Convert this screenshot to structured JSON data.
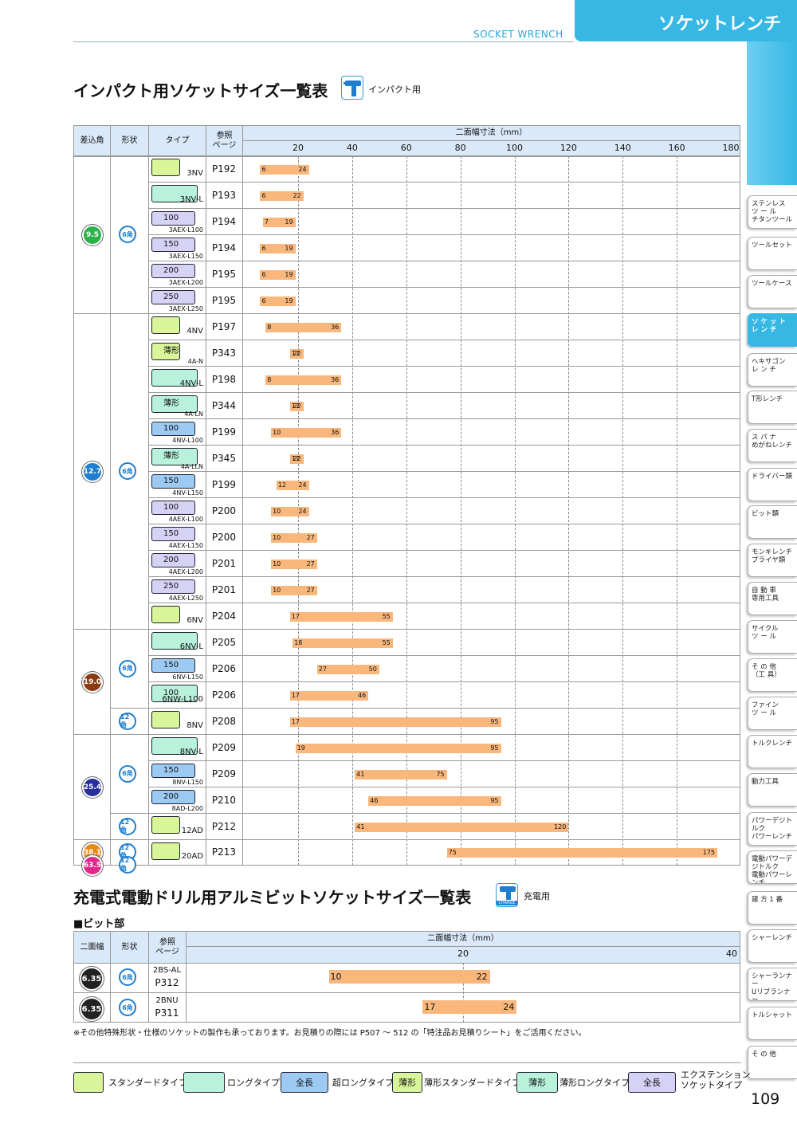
{
  "header": {
    "english": "SOCKET WRENCH",
    "japanese": "ソケットレンチ"
  },
  "sidebar": [
    "ステンレス\nツ ー ル\nチタンツール",
    "ツールセット",
    "ツールケース",
    "ソ ケ ッ ト\nレ ン チ",
    "ヘキサゴン\nレ ン チ",
    "T形レンチ",
    "ス パ ナ\nめがねレンチ",
    "ドライバー類",
    "ビット類",
    "モンキレンチ\nプライヤ類",
    "自 動 車\n専用工具",
    "サイクル\nツ ー ル",
    "そ の 他\n（工 具）",
    "ファイン\nツ ー ル",
    "トルクレンチ",
    "動力工具",
    "パワーデジトルク\nパワーレンチ",
    "電動パワーデジトルク\n電動パワーレンチ\nシンプルトルコン",
    "建 方 1 番",
    "シャーレンチ",
    "シャーランナー\nUリブランナー",
    "トルシャット",
    "そ の 他"
  ],
  "section1": {
    "title": "インパクト用ソケットサイズ一覧表",
    "tag": "インパクト用",
    "headers": {
      "drive": "差込角",
      "shape": "形状",
      "type": "タイプ",
      "ref": "参照\nページ",
      "size": "二面幅寸法（mm）"
    },
    "ticks": [
      "20",
      "40",
      "60",
      "80",
      "100",
      "120",
      "140",
      "160",
      "180"
    ],
    "groups": [
      {
        "drive": "9.5",
        "color": "#2bb34a",
        "rows": [
          0,
          6
        ]
      },
      {
        "drive": "12.7",
        "color": "#1e7fd0",
        "rows": [
          6,
          18
        ]
      },
      {
        "drive": "19.0",
        "color": "#8a3b12",
        "rows": [
          18,
          22
        ]
      },
      {
        "drive": "25.4",
        "color": "#27309a",
        "rows": [
          22,
          26
        ]
      },
      {
        "drive": "38.1",
        "color": "#e88a1a",
        "rows": [
          26,
          27
        ]
      },
      {
        "drive": "63.5",
        "color": "#e0288c",
        "rows": [
          27,
          28
        ]
      }
    ],
    "shapes": [
      {
        "label": "6角",
        "rows": [
          0,
          6
        ]
      },
      {
        "label": "6角",
        "rows": [
          6,
          18
        ]
      },
      {
        "label": "6角",
        "rows": [
          18,
          21
        ]
      },
      {
        "label": "12角",
        "rows": [
          21,
          22
        ]
      },
      {
        "label": "6角",
        "rows": [
          22,
          25
        ]
      },
      {
        "label": "12角",
        "rows": [
          25,
          26
        ]
      },
      {
        "label": "12角",
        "rows": [
          26,
          27
        ]
      },
      {
        "label": "12角",
        "rows": [
          27,
          28
        ]
      }
    ],
    "rows": [
      {
        "kind": "std",
        "label": "",
        "code": "3NV",
        "page": "P192",
        "min": 6,
        "max": 24
      },
      {
        "kind": "long",
        "label": "",
        "code": "3NV-L",
        "page": "P193",
        "min": 6,
        "max": 22
      },
      {
        "kind": "ext",
        "label": "100",
        "code": "3AEX-L100",
        "page": "P194",
        "min": 7,
        "max": 19
      },
      {
        "kind": "ext",
        "label": "150",
        "code": "3AEX-L150",
        "page": "P194",
        "min": 6,
        "max": 19
      },
      {
        "kind": "ext",
        "label": "200",
        "code": "3AEX-L200",
        "page": "P195",
        "min": 6,
        "max": 19
      },
      {
        "kind": "ext",
        "label": "250",
        "code": "3AEX-L250",
        "page": "P195",
        "min": 6,
        "max": 19
      },
      {
        "kind": "std",
        "label": "",
        "code": "4NV",
        "page": "P197",
        "min": 8,
        "max": 36
      },
      {
        "kind": "thin",
        "label": "薄形",
        "code": "4A-N",
        "page": "P343",
        "min": 17,
        "max": 22
      },
      {
        "kind": "long",
        "label": "",
        "code": "4NV-L",
        "page": "P198",
        "min": 8,
        "max": 36
      },
      {
        "kind": "thinlong",
        "label": "薄形",
        "code": "4A-LN",
        "page": "P344",
        "min": 17,
        "max": 22
      },
      {
        "kind": "full",
        "label": "100",
        "code": "4NV-L100",
        "page": "P199",
        "min": 10,
        "max": 36
      },
      {
        "kind": "thinlong",
        "label": "薄形",
        "code": "4A-LLN",
        "page": "P345",
        "min": 17,
        "max": 22
      },
      {
        "kind": "full",
        "label": "150",
        "code": "4NV-L150",
        "page": "P199",
        "min": 12,
        "max": 24
      },
      {
        "kind": "ext",
        "label": "100",
        "code": "4AEX-L100",
        "page": "P200",
        "min": 10,
        "max": 24
      },
      {
        "kind": "ext",
        "label": "150",
        "code": "4AEX-L150",
        "page": "P200",
        "min": 10,
        "max": 27
      },
      {
        "kind": "ext",
        "label": "200",
        "code": "4AEX-L200",
        "page": "P201",
        "min": 10,
        "max": 27
      },
      {
        "kind": "ext",
        "label": "250",
        "code": "4AEX-L250",
        "page": "P201",
        "min": 10,
        "max": 27
      },
      {
        "kind": "std",
        "label": "",
        "code": "6NV",
        "page": "P204",
        "min": 17,
        "max": 55
      },
      {
        "kind": "long",
        "label": "",
        "code": "6NV-L",
        "page": "P205",
        "min": 18,
        "max": 55
      },
      {
        "kind": "full",
        "label": "150",
        "code": "6NV-L150",
        "page": "P206",
        "min": 27,
        "max": 50
      },
      {
        "kind": "long",
        "label": "100",
        "code": "6NW-L100",
        "page": "P206",
        "min": 17,
        "max": 46
      },
      {
        "kind": "std",
        "label": "",
        "code": "8NV",
        "page": "P208",
        "min": 17,
        "max": 95
      },
      {
        "kind": "long",
        "label": "",
        "code": "8NV-L",
        "page": "P209",
        "min": 19,
        "max": 95
      },
      {
        "kind": "full",
        "label": "150",
        "code": "8NV-L150",
        "page": "P209",
        "min": 41,
        "max": 75
      },
      {
        "kind": "full",
        "label": "200",
        "code": "8AD-L200",
        "page": "P210",
        "min": 46,
        "max": 95
      },
      {
        "kind": "std",
        "label": "",
        "code": "12AD",
        "page": "P212",
        "min": 41,
        "max": 120
      },
      {
        "kind": "std",
        "label": "",
        "code": "20AD",
        "page": "P213",
        "min": 75,
        "max": 175
      }
    ]
  },
  "section2": {
    "title": "充電式電動ドリル用アルミビットソケットサイズ一覧表",
    "tag": "充電用",
    "icon_text": "CHARGE",
    "subtitle": "■ビット部",
    "headers": {
      "size": "二面幅",
      "shape": "形状",
      "ref": "参照\nページ",
      "range": "二面幅寸法（mm）"
    },
    "ticks": [
      "20",
      "40"
    ],
    "rows": [
      {
        "size": "6.35",
        "shape": "6角",
        "code": "2BS-AL",
        "page": "P312",
        "min": 10,
        "max": 22
      },
      {
        "size": "6.35",
        "shape": "6角",
        "code": "2BNU",
        "page": "P311",
        "min": 17,
        "max": 24
      }
    ]
  },
  "note": "※その他特殊形状・仕様のソケットの製作も承っております。お見積りの際には P507 ～ 512 の「特注品お見積りシート」をご活用ください。",
  "legend": [
    {
      "box": "",
      "text": "スタンダードタイプ",
      "color": "#d9f59a"
    },
    {
      "box": "",
      "text": "ロングタイプ",
      "color": "#b8f2dc"
    },
    {
      "box": "全長",
      "text": "超ロングタイプ",
      "color": "#9ccaf3"
    },
    {
      "box": "薄形",
      "text": "薄形スタンダードタイプ",
      "color": "#d9f59a"
    },
    {
      "box": "薄形",
      "text": "薄形ロングタイプ",
      "color": "#b8f2dc"
    },
    {
      "box": "全長",
      "text": "エクステンション\nソケットタイプ",
      "color": "#d6d2f5"
    }
  ],
  "page_number": "109",
  "colors": {
    "accent": "#37b7e4",
    "bar": "#f9b77c",
    "header_bg": "#d9e9f9"
  }
}
